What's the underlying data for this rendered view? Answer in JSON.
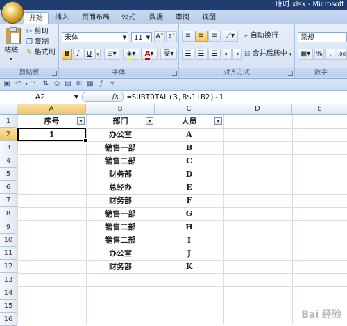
{
  "window": {
    "title": "临时.xlsx - Microsoft"
  },
  "tabs": [
    {
      "label": "开始",
      "active": true
    },
    {
      "label": "插入"
    },
    {
      "label": "页面布局"
    },
    {
      "label": "公式"
    },
    {
      "label": "数据"
    },
    {
      "label": "审阅"
    },
    {
      "label": "视图"
    }
  ],
  "ribbon": {
    "clipboard": {
      "label": "剪贴板",
      "paste": "粘贴",
      "cut": "剪切",
      "copy": "复制",
      "format_painter": "格式刷"
    },
    "font": {
      "label": "字体",
      "font_name": "宋体",
      "font_size": "11",
      "bold": "B",
      "italic": "I",
      "underline": "U",
      "font_color_glyph": "A",
      "phonetic": "雯"
    },
    "alignment": {
      "label": "对齐方式",
      "wrap_text": "自动换行",
      "merge_center": "合并后居中"
    },
    "number": {
      "label": "数字",
      "format": "常规"
    }
  },
  "formula_bar": {
    "name_box": "A2",
    "fx": "fx",
    "formula": "=SUBTOTAL(3,B$1:B2)-1"
  },
  "columns": [
    "A",
    "B",
    "C",
    "D",
    "E"
  ],
  "rows": [
    "1",
    "2",
    "3",
    "4",
    "5",
    "6",
    "7",
    "8",
    "9",
    "10",
    "11",
    "12",
    "13",
    "14",
    "15",
    "16"
  ],
  "sheet": {
    "headers": {
      "a": "序号",
      "b": "部门",
      "c": "人员"
    },
    "a2": "1",
    "departments": [
      "办公室",
      "销售一部",
      "销售二部",
      "财务部",
      "总经办",
      "财务部",
      "销售一部",
      "销售二部",
      "销售二部",
      "办公室",
      "财务部"
    ],
    "people": [
      "A",
      "B",
      "C",
      "D",
      "E",
      "F",
      "G",
      "H",
      "I",
      "J",
      "K"
    ]
  },
  "watermark": "Bai 经验"
}
